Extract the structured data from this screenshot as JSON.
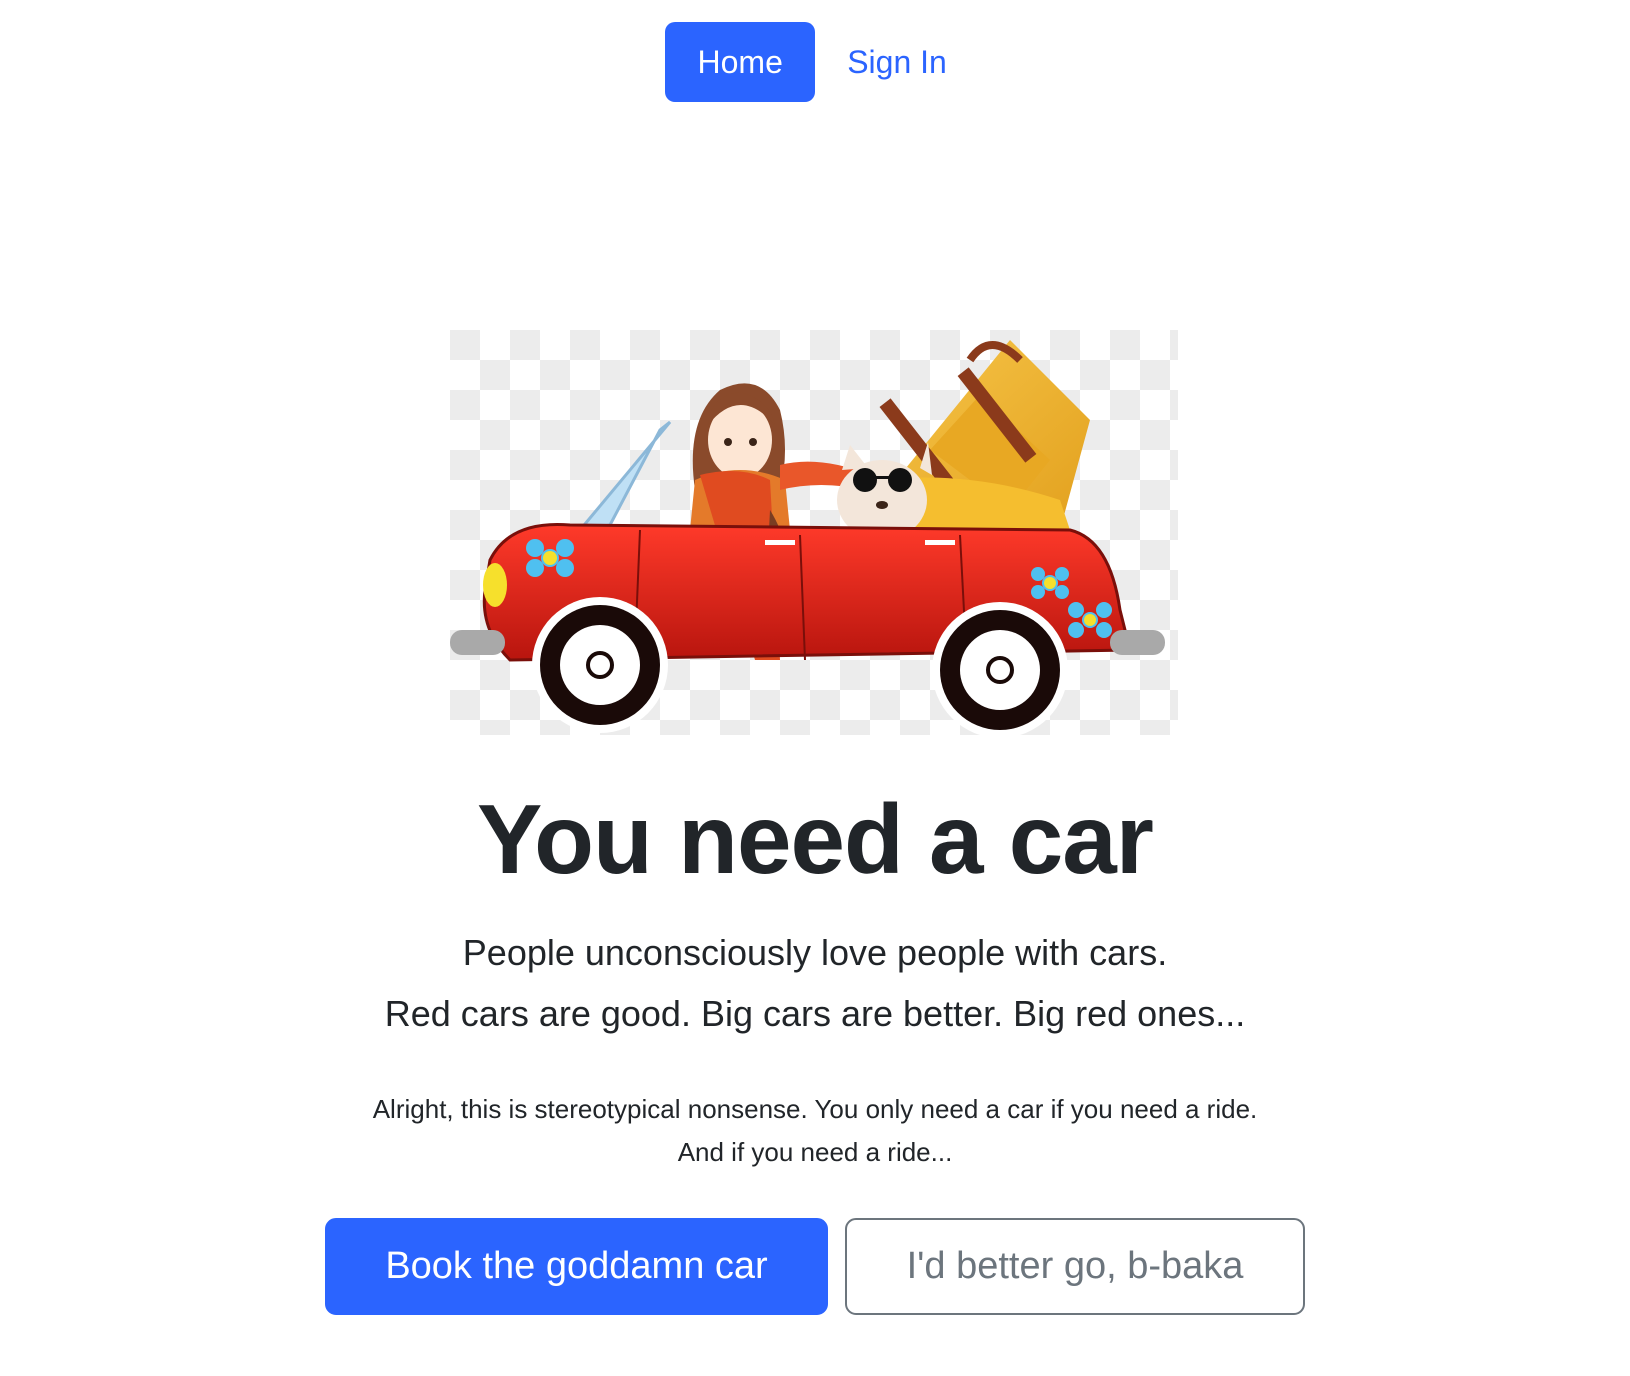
{
  "nav": {
    "items": [
      {
        "label": "Home",
        "active": true
      },
      {
        "label": "Sign In",
        "active": false
      }
    ]
  },
  "hero": {
    "image_icon": "red-convertible-car-illustration"
  },
  "main": {
    "headline": "You need a car",
    "lead_line_1": "People unconsciously love people with cars.",
    "lead_line_2": "Red cars are good. Big cars are better. Big red ones...",
    "small_line_1": "Alright, this is stereotypical nonsense. You only need a car if you need a ride.",
    "small_line_2": "And if you need a ride..."
  },
  "actions": {
    "primary_label": "Book the goddamn car",
    "secondary_label": "I'd better go, b-baka"
  },
  "colors": {
    "primary": "#2b64ff",
    "secondary": "#6c757d",
    "text": "#212529",
    "car_red": "#d9231b"
  }
}
